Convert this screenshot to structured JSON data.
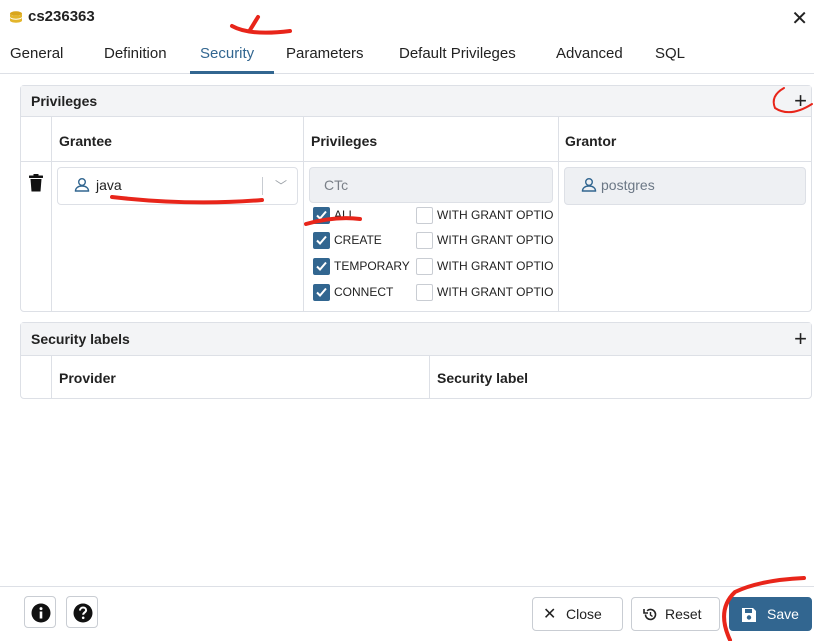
{
  "dialog": {
    "title": "cs236363"
  },
  "tabs": [
    {
      "label": "General"
    },
    {
      "label": "Definition"
    },
    {
      "label": "Security"
    },
    {
      "label": "Parameters"
    },
    {
      "label": "Default Privileges"
    },
    {
      "label": "Advanced"
    },
    {
      "label": "SQL"
    }
  ],
  "active_tab": "Security",
  "privileges": {
    "title": "Privileges",
    "columns": {
      "grantee": "Grantee",
      "privileges": "Privileges",
      "grantor": "Grantor"
    },
    "row": {
      "grantee": "java",
      "privileges_value": "CTc",
      "grantor": "postgres",
      "options": [
        {
          "label": "ALL",
          "checked": true,
          "grant_label": "WITH GRANT OPTIO",
          "grant_checked": false
        },
        {
          "label": "CREATE",
          "checked": true,
          "grant_label": "WITH GRANT OPTIO",
          "grant_checked": false
        },
        {
          "label": "TEMPORARY",
          "checked": true,
          "grant_label": "WITH GRANT OPTIO",
          "grant_checked": false
        },
        {
          "label": "CONNECT",
          "checked": true,
          "grant_label": "WITH GRANT OPTIO",
          "grant_checked": false
        }
      ]
    }
  },
  "security_labels": {
    "title": "Security labels",
    "columns": {
      "provider": "Provider",
      "label": "Security label"
    }
  },
  "footer": {
    "close_label": "Close",
    "reset_label": "Reset",
    "save_label": "Save"
  },
  "colors": {
    "accent": "#326690",
    "annotation": "#e8251a"
  }
}
